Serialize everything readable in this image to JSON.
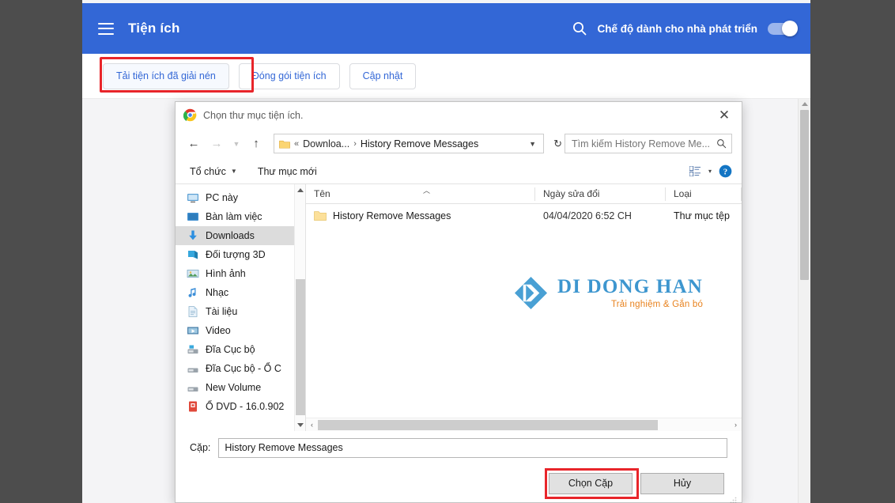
{
  "browser": {
    "scrollbar": {
      "icon": "scroll-up-arrow-icon"
    }
  },
  "ext_page": {
    "menu_icon": "hamburger-menu-icon",
    "title": "Tiện ích",
    "search_icon": "search-icon",
    "dev_mode_label": "Chế độ dành cho nhà phát triển",
    "dev_mode_on": true,
    "toolbar_buttons": [
      {
        "label": "Tải tiện ích đã giải nén",
        "highlighted": true
      },
      {
        "label": "Đóng gói tiện ích",
        "highlighted": false
      },
      {
        "label": "Cập nhật",
        "highlighted": false
      }
    ],
    "accent_color": "#3367d6",
    "highlight_color": "#e8252a"
  },
  "dialog": {
    "app_icon": "chrome-logo-icon",
    "title": "Chọn thư mục tiện ích.",
    "close_label": "✕",
    "nav": {
      "back_icon": "arrow-left-icon",
      "forward_icon": "arrow-right-icon",
      "recent_icon": "chevron-down-icon",
      "up_icon": "arrow-up-icon",
      "folder_icon": "folder-icon",
      "breadcrumb_sep_start": "«",
      "breadcrumb_parent": "Downloa...",
      "breadcrumb_sep": "›",
      "breadcrumb_current": "History Remove Messages",
      "dropdown_icon": "chevron-down-icon",
      "refresh_icon": "refresh-icon"
    },
    "search": {
      "placeholder": "Tìm kiếm History Remove Me...",
      "value": "",
      "icon": "search-icon"
    },
    "commands": {
      "organize": "Tổ chức",
      "new_folder": "Thư mục mới",
      "view_icon": "list-view-icon",
      "view_caret": "▾",
      "help_icon": "help-icon"
    },
    "sidebar": [
      {
        "label": "PC này",
        "icon": "computer-icon",
        "selected": false
      },
      {
        "label": "Bàn làm việc",
        "icon": "desktop-icon",
        "selected": false
      },
      {
        "label": "Downloads",
        "icon": "downloads-icon",
        "selected": true
      },
      {
        "label": "Đối tượng 3D",
        "icon": "3d-objects-icon",
        "selected": false
      },
      {
        "label": "Hình ảnh",
        "icon": "pictures-icon",
        "selected": false
      },
      {
        "label": "Nhạc",
        "icon": "music-icon",
        "selected": false
      },
      {
        "label": "Tài liệu",
        "icon": "documents-icon",
        "selected": false
      },
      {
        "label": "Video",
        "icon": "videos-icon",
        "selected": false
      },
      {
        "label": "Đĩa Cục bộ",
        "icon": "local-disk-icon",
        "selected": false
      },
      {
        "label": "Đĩa Cục bộ - Ổ C",
        "icon": "local-disk-icon",
        "selected": false
      },
      {
        "label": "New Volume",
        "icon": "local-disk-icon",
        "selected": false
      },
      {
        "label": "Ổ DVD - 16.0.902",
        "icon": "dvd-drive-icon",
        "selected": false
      }
    ],
    "columns": [
      {
        "label": "Tên",
        "sorted": true
      },
      {
        "label": "Ngày sửa đổi",
        "sorted": false
      },
      {
        "label": "Loại",
        "sorted": false
      }
    ],
    "sort_caret": "︿",
    "rows": [
      {
        "icon": "folder-icon",
        "name": "History Remove Messages",
        "date_modified": "04/04/2020 6:52 CH",
        "type": "Thư mục tệp"
      }
    ],
    "hscroll": {
      "left_icon": "‹",
      "right_icon": "›"
    },
    "vscroll": {
      "up_icon": "▲",
      "down_icon": "▼"
    },
    "footer": {
      "folder_label": "Cặp:",
      "folder_value": "History Remove Messages",
      "confirm_button": "Chọn Cặp",
      "cancel_button": "Hủy",
      "confirm_highlighted": true
    }
  },
  "watermark": {
    "name": "DI DONG HAN",
    "tagline": "Trải nghiệm & Gắn bó",
    "mark_icon": "diamond-logo-icon",
    "name_color": "#3d96cf",
    "tagline_color": "#e8821e"
  }
}
